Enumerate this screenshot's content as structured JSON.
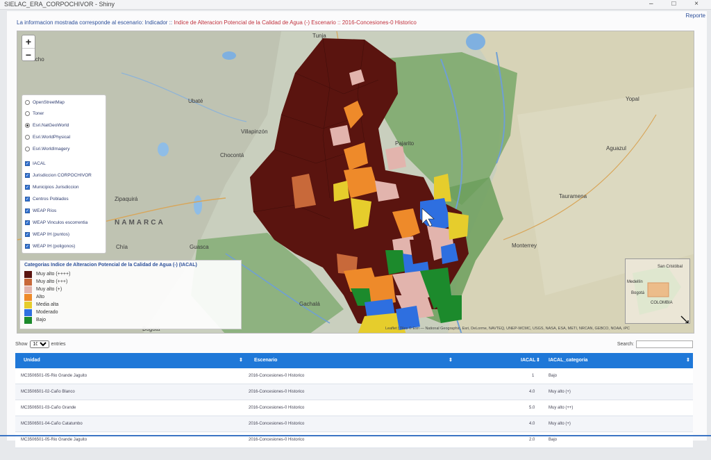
{
  "window": {
    "title": "SIELAC_ERA_CORPOCHIVOR - Shiny",
    "controls": "–  □  ×"
  },
  "header": {
    "info_prefix": "La informacion mostrada corresponde al escenario: Indicador :: ",
    "info_indicator": "Indice de Alteracion Potencial de la Calidad de Agua (-)",
    "info_mid": " Escenario :: ",
    "info_scenario": "2016-Concesiones-0 Historico",
    "right_link": "Reporte"
  },
  "map": {
    "zoom_in": "+",
    "zoom_out": "−",
    "labels": {
      "tunja": "Tunja",
      "ubate": "Ubaté",
      "villapinzon": "Villapinzón",
      "chocanta": "Chocontá",
      "zipaquira": "Zipaquirá",
      "cundinamarca": "NAMARCA",
      "chia": "Chía",
      "guasca": "Guasca",
      "gachala": "Gachalá",
      "bogota": "Bogotá",
      "yopal": "Yopal",
      "aguazul": "Aguazul",
      "tauramena": "Tauramena",
      "monterrey": "Monterrey",
      "pajarito": "Pajarito",
      "pacho": "Pacho"
    },
    "base_layers": [
      "OpenStreetMap",
      "Toner",
      "Esri.NatGeoWorld",
      "Esri.WorldPhysical",
      "Esri.WorldImagery"
    ],
    "base_selected": "Esri.NatGeoWorld",
    "overlays": [
      "IACAL",
      "Jurisdiccion CORPOCHIVOR",
      "Municipios Jurisdiccion",
      "Centros Poblados",
      "WEAP Ríos",
      "WEAP Vinculos escorrentia",
      "WEAP IH (puntos)",
      "WEAP IH (poligonos)"
    ],
    "legend": {
      "title": "Categorias Indice de Alteracion Potencial de la Calidad de Agua (-) (IACAL)",
      "items": [
        {
          "label": "Muy alto (++++)",
          "color": "#5a140f"
        },
        {
          "label": "Muy alto (+++)",
          "color": "#c8693a"
        },
        {
          "label": "Muy alto (+)",
          "color": "#e2b4ad"
        },
        {
          "label": "Alto",
          "color": "#ee8a2a"
        },
        {
          "label": "Media alta",
          "color": "#e6cd2c"
        },
        {
          "label": "Moderado",
          "color": "#2e6fe0"
        },
        {
          "label": "Bajo",
          "color": "#1c8a2c"
        }
      ]
    },
    "minimap": {
      "city1": "San Cristóbal",
      "city2": "Medellín",
      "city3": "Bogotá",
      "city4": "COLOMBIA"
    },
    "attribution": "Leaflet | Tiles © Esri — National Geographic, Esri, DeLorme, NAVTEQ, UNEP-WCMC, USGS, NASA, ESA, METI, NRCAN, GEBCO, NOAA, iPC"
  },
  "table_controls": {
    "show_label": "Show",
    "entries_label": "entries",
    "page_size": "10",
    "search_label": "Search:"
  },
  "table": {
    "columns": [
      "Unidad",
      "Escenario",
      "IACAL",
      "IACAL_categoria"
    ],
    "sort_icon": "⇕",
    "rows": [
      [
        "MC3506501-05-Rio Grande Jaguito",
        "2016-Concesiones-0 Historico",
        "1",
        "Bajo"
      ],
      [
        "MC3506501-02-Caño Blanco",
        "2016-Concesiones-0 Historico",
        "4.0",
        "Muy alto (+)"
      ],
      [
        "MC3506501-03-Caño Grande",
        "2016-Concesiones-0 Historico",
        "5.0",
        "Muy alto (++)"
      ],
      [
        "MC3506501-04-Caño Catatumbo",
        "2016-Concesiones-0 Historico",
        "4.0",
        "Muy alto (+)"
      ],
      [
        "MC3506501-05-Rio Grande Jaguito",
        "2016-Concesiones-0 Historico",
        "2.0",
        "Bajo"
      ]
    ]
  }
}
